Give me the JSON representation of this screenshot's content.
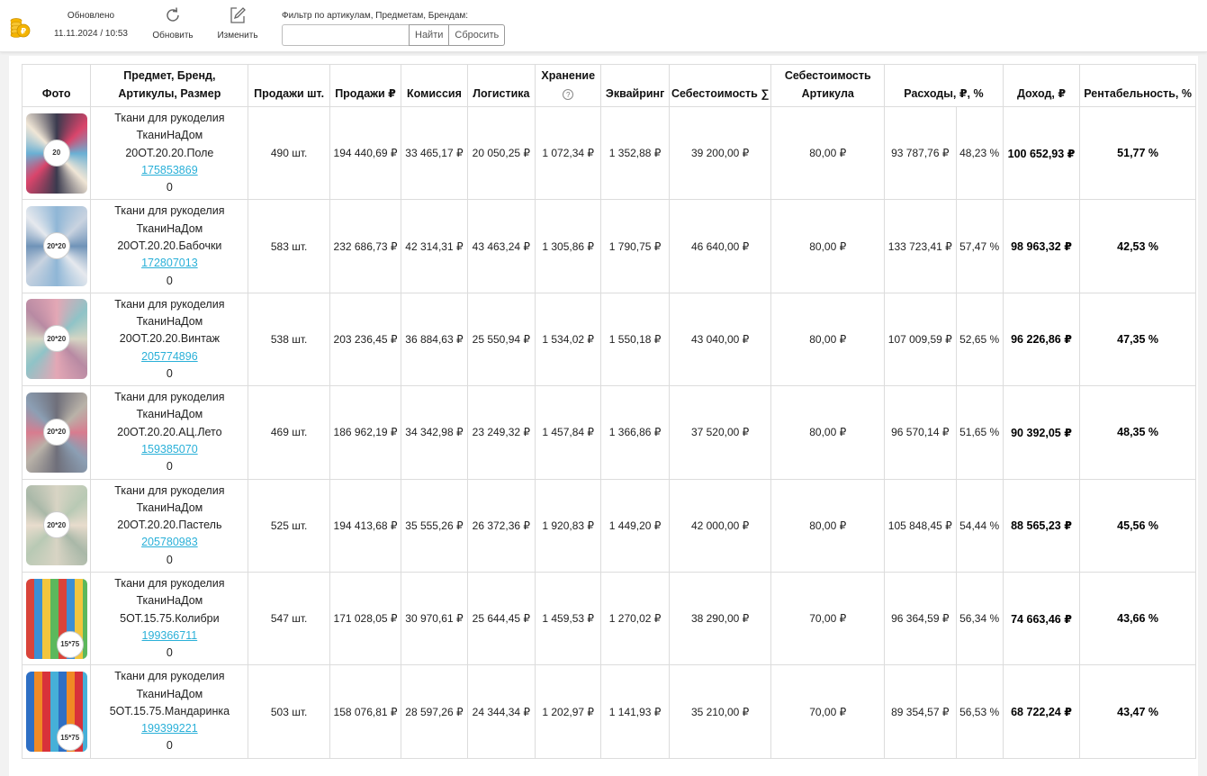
{
  "toolbar": {
    "updated_label": "Обновлено",
    "updated_time": "11.11.2024 / 10:53",
    "refresh_label": "Обновить",
    "edit_label": "Изменить",
    "filter_label": "Фильтр по артикулам, Предметам, Брендам:",
    "filter_value": "",
    "find_label": "Найти",
    "reset_label": "Сбросить"
  },
  "headers": {
    "photo": "Фото",
    "product_line1": "Предмет, Бренд,",
    "product_line2": "Артикулы, Размер",
    "sales_qty": "Продажи шт.",
    "sales_rub": "Продажи ₽",
    "commission": "Комиссия",
    "logistics": "Логистика",
    "storage": "Хранение",
    "storage_help": "?",
    "acquiring": "Эквайринг",
    "cost_sum": "Себестоимость ∑",
    "cost_article_line1": "Себестоимость",
    "cost_article_line2": "Артикула",
    "expenses": "Расходы, ₽, %",
    "income": "Доход, ₽",
    "profitability": "Рентабельность, %"
  },
  "colors": {
    "link": "#2ab0d8",
    "border": "#dcdcdc",
    "page_bg": "#f2f2f2",
    "logo_coin": "#f4b400"
  },
  "rows": [
    {
      "subject": "Ткани для рукоделия",
      "brand": "ТканиНаДом",
      "article": "20ОТ.20.20.Поле",
      "id": "175853869",
      "size": "0",
      "thumb_badge": "20",
      "thumb_colors": [
        "#3a3a4e",
        "#d9456b",
        "#6ab0d4",
        "#f0e6d6"
      ],
      "sales_qty": "490 шт.",
      "sales_rub": "194 440,69 ₽",
      "commission": "33 465,17 ₽",
      "logistics": "20 050,25 ₽",
      "storage": "1 072,34 ₽",
      "acquiring": "1 352,88 ₽",
      "cost_sum": "39 200,00 ₽",
      "cost_article": "80,00 ₽",
      "expenses_rub": "93 787,76 ₽",
      "expenses_pct": "48,23 %",
      "income": "100 652,93 ₽",
      "profitability": "51,77 %"
    },
    {
      "subject": "Ткани для рукоделия",
      "brand": "ТканиНаДом",
      "article": "20ОТ.20.20.Бабочки",
      "id": "172807013",
      "size": "0",
      "thumb_badge": "20*20",
      "thumb_colors": [
        "#8fb6d6",
        "#c9d3e0",
        "#6f93b8",
        "#e6e9ee"
      ],
      "sales_qty": "583 шт.",
      "sales_rub": "232 686,73 ₽",
      "commission": "42 314,31 ₽",
      "logistics": "43 463,24 ₽",
      "storage": "1 305,86 ₽",
      "acquiring": "1 790,75 ₽",
      "cost_sum": "46 640,00 ₽",
      "cost_article": "80,00 ₽",
      "expenses_rub": "133 723,41 ₽",
      "expenses_pct": "57,47 %",
      "income": "98 963,32 ₽",
      "profitability": "42,53 %"
    },
    {
      "subject": "Ткани для рукоделия",
      "brand": "ТканиНаДом",
      "article": "20ОТ.20.20.Винтаж",
      "id": "205774896",
      "size": "0",
      "thumb_badge": "20*20",
      "thumb_colors": [
        "#e3a7b5",
        "#8fc3c7",
        "#d6d6c4",
        "#b88aa3"
      ],
      "sales_qty": "538 шт.",
      "sales_rub": "203 236,45 ₽",
      "commission": "36 884,63 ₽",
      "logistics": "25 550,94 ₽",
      "storage": "1 534,02 ₽",
      "acquiring": "1 550,18 ₽",
      "cost_sum": "43 040,00 ₽",
      "cost_article": "80,00 ₽",
      "expenses_rub": "107 009,59 ₽",
      "expenses_pct": "52,65 %",
      "income": "96 226,86 ₽",
      "profitability": "47,35 %"
    },
    {
      "subject": "Ткани для рукоделия",
      "brand": "ТканиНаДом",
      "article": "20ОТ.20.20.АЦ.Лето",
      "id": "159385070",
      "size": "0",
      "thumb_badge": "20*20",
      "thumb_colors": [
        "#6f6f7a",
        "#b9b2a8",
        "#d87c8f",
        "#8c9fb4"
      ],
      "sales_qty": "469 шт.",
      "sales_rub": "186 962,19 ₽",
      "commission": "34 342,98 ₽",
      "logistics": "23 249,32 ₽",
      "storage": "1 457,84 ₽",
      "acquiring": "1 366,86 ₽",
      "cost_sum": "37 520,00 ₽",
      "cost_article": "80,00 ₽",
      "expenses_rub": "96 570,14 ₽",
      "expenses_pct": "51,65 %",
      "income": "90 392,05 ₽",
      "profitability": "48,35 %"
    },
    {
      "subject": "Ткани для рукоделия",
      "brand": "ТканиНаДом",
      "article": "20ОТ.20.20.Пастель",
      "id": "205780983",
      "size": "0",
      "thumb_badge": "20*20",
      "thumb_colors": [
        "#d8d4c4",
        "#b8c9b4",
        "#e8dccd",
        "#a9b8a8"
      ],
      "sales_qty": "525 шт.",
      "sales_rub": "194 413,68 ₽",
      "commission": "35 555,26 ₽",
      "logistics": "26 372,36 ₽",
      "storage": "1 920,83 ₽",
      "acquiring": "1 449,20 ₽",
      "cost_sum": "42 000,00 ₽",
      "cost_article": "80,00 ₽",
      "expenses_rub": "105 848,45 ₽",
      "expenses_pct": "54,44 %",
      "income": "88 565,23 ₽",
      "profitability": "45,56 %"
    },
    {
      "subject": "Ткани для рукоделия",
      "brand": "ТканиНаДом",
      "article": "5ОТ.15.75.Колибри",
      "id": "199366711",
      "size": "0",
      "thumb_badge": "15*75",
      "thumb_colors": [
        "#d9443a",
        "#3b8fd4",
        "#f2c53d",
        "#5cb85c"
      ],
      "sales_qty": "547 шт.",
      "sales_rub": "171 028,05 ₽",
      "commission": "30 970,61 ₽",
      "logistics": "25 644,45 ₽",
      "storage": "1 459,53 ₽",
      "acquiring": "1 270,02 ₽",
      "cost_sum": "38 290,00 ₽",
      "cost_article": "70,00 ₽",
      "expenses_rub": "96 364,59 ₽",
      "expenses_pct": "56,34 %",
      "income": "74 663,46 ₽",
      "profitability": "43,66 %"
    },
    {
      "subject": "Ткани для рукоделия",
      "brand": "ТканиНаДом",
      "article": "5ОТ.15.75.Мандаринка",
      "id": "199399221",
      "size": "0",
      "thumb_badge": "15*75",
      "thumb_colors": [
        "#2e6fc4",
        "#f08a24",
        "#d8323a",
        "#46b0d8"
      ],
      "sales_qty": "503 шт.",
      "sales_rub": "158 076,81 ₽",
      "commission": "28 597,26 ₽",
      "logistics": "24 344,34 ₽",
      "storage": "1 202,97 ₽",
      "acquiring": "1 141,93 ₽",
      "cost_sum": "35 210,00 ₽",
      "cost_article": "70,00 ₽",
      "expenses_rub": "89 354,57 ₽",
      "expenses_pct": "56,53 %",
      "income": "68 722,24 ₽",
      "profitability": "43,47 %"
    }
  ]
}
